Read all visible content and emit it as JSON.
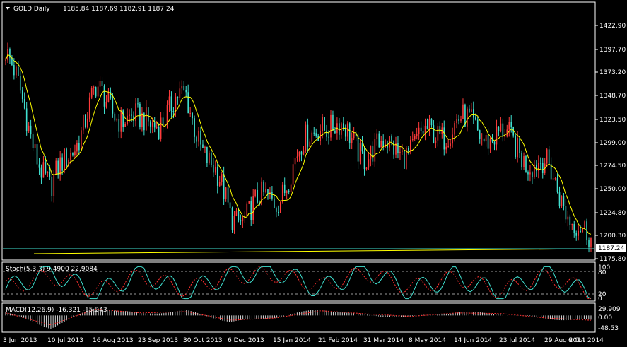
{
  "header": {
    "symbol": "GOLD,Daily",
    "ohlc": "1185.84 1187.69 1182.91 1187.24"
  },
  "price_panel": {
    "current_price_label": "1187.24",
    "y_tick_labels": [
      "1422.90",
      "1397.70",
      "1373.20",
      "1348.70",
      "1323.50",
      "1299.00",
      "1274.50",
      "1250.00",
      "1224.80",
      "1200.30",
      "1175.80"
    ]
  },
  "stoch_panel": {
    "label": "Stoch(5,3,3) 9.4900 22.9084",
    "ticks": [
      "100",
      "80",
      "20",
      "0"
    ]
  },
  "macd_panel": {
    "label": "MACD(12,26,9) -16.321 -15.243",
    "ticks": [
      "29.909",
      "0.00",
      "-48.53"
    ]
  },
  "x_axis": {
    "labels": [
      "3 Jun 2013",
      "10 Jul 2013",
      "16 Aug 2013",
      "23 Sep 2013",
      "30 Oct 2013",
      "6 Dec 2013",
      "15 Jan 2014",
      "21 Feb 2014",
      "31 Mar 2014",
      "8 May 2014",
      "14 Jun 2014",
      "23 Jul 2014",
      "29 Aug 2014",
      "6 Oct 2014"
    ]
  },
  "colors": {
    "background": "#000000",
    "bull_candle": "#ff3b3b",
    "bear_candle": "#40e0d0",
    "moving_average": "#ffff00",
    "stoch_main": "#40e0d0",
    "stoch_signal": "#ff3030",
    "macd_hist": "#d8d8d8",
    "macd_signal": "#ff3030",
    "axis": "#ffffff",
    "trendline": "#ffff00",
    "support_line": "#40e0d0"
  },
  "chart_data": [
    {
      "type": "line",
      "title": "GOLD,Daily",
      "ylim": [
        1175.8,
        1435.0
      ],
      "x": [
        "3 Jun 2013",
        "10 Jul 2013",
        "16 Aug 2013",
        "23 Sep 2013",
        "30 Oct 2013",
        "6 Dec 2013",
        "15 Jan 2014",
        "21 Feb 2014",
        "31 Mar 2014",
        "8 May 2014",
        "14 Jun 2014",
        "23 Jul 2014",
        "29 Aug 2014",
        "6 Oct 2014"
      ],
      "series": [
        {
          "values": [
            1395,
            1245,
            1350,
            1315,
            1345,
            1220,
            1240,
            1325,
            1290,
            1295,
            1320,
            1305,
            1270,
            1187
          ]
        }
      ]
    },
    {
      "type": "line",
      "title": "Stoch(5,3,3) 9.4900 22.9084",
      "ylim": [
        0,
        100
      ],
      "series": [
        {
          "values": [
            30,
            85,
            15,
            80,
            20,
            75,
            85,
            30,
            90,
            25,
            70,
            15,
            80,
            10
          ]
        },
        {
          "values": [
            35,
            70,
            25,
            70,
            30,
            70,
            75,
            40,
            80,
            35,
            65,
            25,
            70,
            23
          ]
        }
      ]
    },
    {
      "type": "bar",
      "title": "MACD(12,26,9) -16.321 -15.243",
      "ylim": [
        -48.53,
        29.909
      ],
      "series": [
        {
          "values": [
            10,
            -40,
            25,
            5,
            15,
            -20,
            -5,
            20,
            0,
            -5,
            10,
            5,
            -10,
            -16.321
          ]
        },
        {
          "values": [
            8,
            -30,
            20,
            8,
            12,
            -15,
            -8,
            15,
            5,
            -3,
            8,
            6,
            -8,
            -15.243
          ]
        }
      ]
    }
  ]
}
